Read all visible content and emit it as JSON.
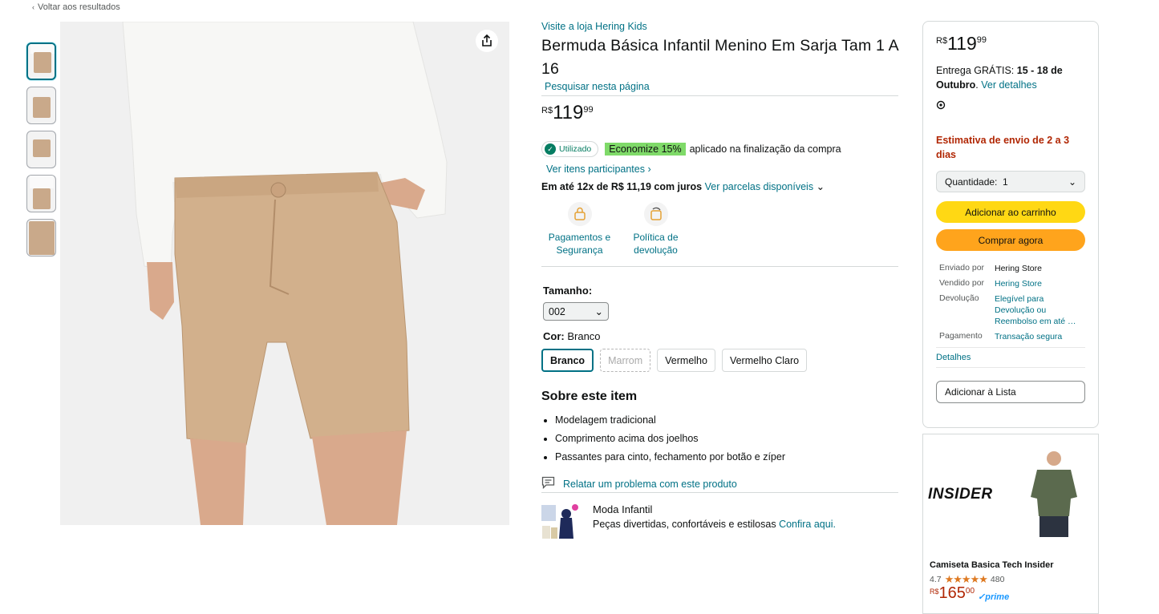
{
  "back_link": "Voltar aos resultados",
  "product": {
    "store_link": "Visite a loja Hering Kids",
    "title": "Bermuda Básica Infantil Menino Em Sarja Tam 1 A 16",
    "search_page": "Pesquisar nesta página",
    "price": {
      "currency": "R$",
      "whole": "119",
      "fraction": "99"
    },
    "coupon": {
      "badge": "Utilizado",
      "highlight": "Economize 15%",
      "text": "aplicado na finalização da compra",
      "see_items": "Ver itens participantes"
    },
    "installments": {
      "bold": "Em até 12x de R$ 11,19 com juros",
      "link": "Ver parcelas disponíveis"
    },
    "badges": [
      {
        "icon": "lock-payment-icon",
        "label": "Pagamentos e Segurança"
      },
      {
        "icon": "return-policy-icon",
        "label": "Política de devolução"
      }
    ],
    "size": {
      "label": "Tamanho:",
      "selected": "002"
    },
    "color": {
      "label": "Cor:",
      "selected": "Branco"
    },
    "swatches": [
      {
        "label": "Branco",
        "state": "selected"
      },
      {
        "label": "Marrom",
        "state": "unavailable"
      },
      {
        "label": "Vermelho",
        "state": "normal"
      },
      {
        "label": "Vermelho Claro",
        "state": "normal"
      }
    ],
    "about": {
      "heading": "Sobre este item",
      "bullets": [
        "Modelagem tradicional",
        "Comprimento acima dos joelhos",
        "Passantes para cinto, fechamento por botão e zíper"
      ]
    },
    "report": "Relatar um problema com este produto",
    "moda": {
      "title": "Moda Infantil",
      "text": "Peças divertidas, confortáveis e estilosas",
      "link": "Confira aqui."
    }
  },
  "buybox": {
    "price": {
      "currency": "R$",
      "whole": "119",
      "fraction": "99"
    },
    "delivery_prefix": "Entrega GRÁTIS:",
    "delivery_date": "15 - 18 de Outubro",
    "delivery_link": "Ver detalhes",
    "ship_estimate": "Estimativa de envio de 2 a 3 dias",
    "quantity": "Quantidade:  1",
    "add_to_cart": "Adicionar ao carrinho",
    "buy_now": "Comprar agora",
    "info": {
      "shipped_by_k": "Enviado por",
      "shipped_by_v": "Hering Store",
      "sold_by_k": "Vendido por",
      "sold_by_v": "Hering Store",
      "return_k": "Devolução",
      "return_v": "Elegível para Devolução ou Reembolso em até …",
      "payment_k": "Pagamento",
      "payment_v": "Transação segura"
    },
    "details": "Detalhes",
    "add_to_list": "Adicionar à Lista"
  },
  "ad": {
    "brand": "INSIDER",
    "name": "Camiseta Basica Tech Insider",
    "rating": "4.7",
    "stars": "★★★★★",
    "reviews": "480",
    "price": {
      "currency": "R$",
      "whole": "165",
      "fraction": "00"
    },
    "prime": "✓prime"
  },
  "colors": {
    "link": "#007185",
    "cart": "#ffd814",
    "buy": "#ffa41c",
    "deal": "#b12704",
    "coupon": "#7fda69"
  }
}
